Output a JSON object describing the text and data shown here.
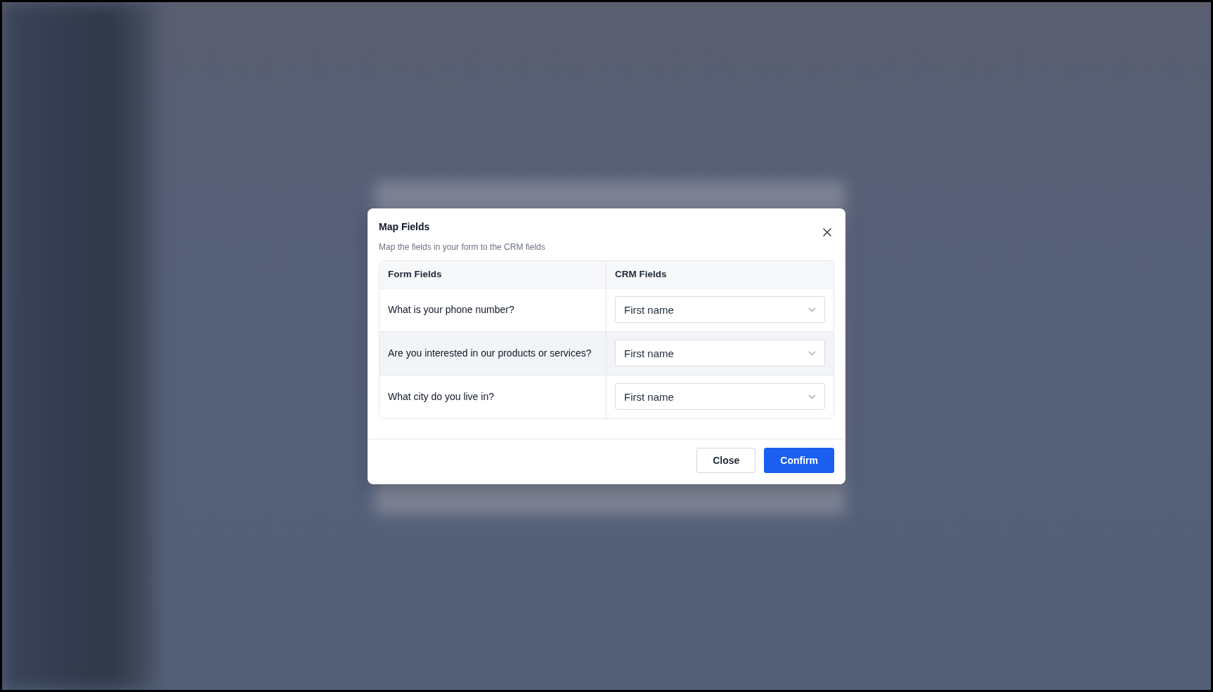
{
  "dialog": {
    "title": "Map Fields",
    "subtitle": "Map the fields in your form to the CRM fields",
    "table": {
      "columns": [
        "Form Fields",
        "CRM Fields"
      ],
      "rows": [
        {
          "form_field": "What is your phone number?",
          "crm_field": "First name",
          "highlighted": false
        },
        {
          "form_field": "Are you interested in our products or services?",
          "crm_field": "First name",
          "highlighted": true
        },
        {
          "form_field": "What city do you live in?",
          "crm_field": "First name",
          "highlighted": false
        }
      ]
    },
    "buttons": [
      {
        "label": "Close",
        "kind": "secondary"
      },
      {
        "label": "Confirm",
        "kind": "primary"
      }
    ]
  }
}
